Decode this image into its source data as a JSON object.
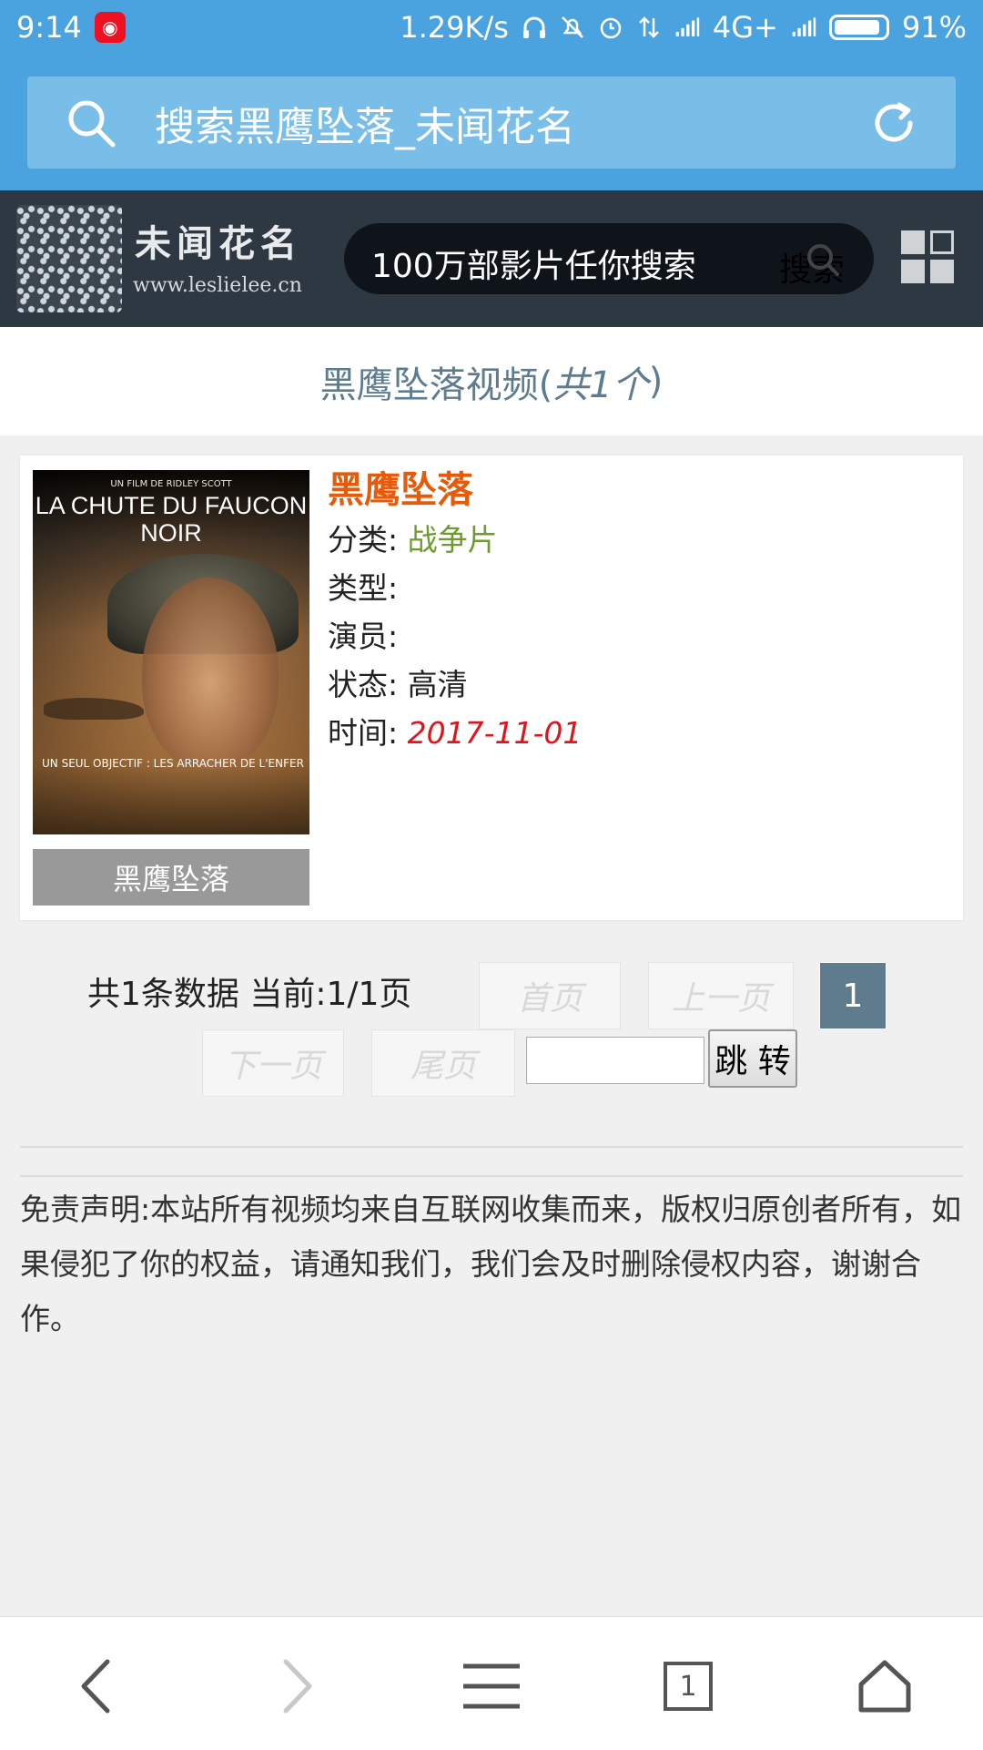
{
  "status_bar": {
    "time": "9:14",
    "net_speed": "1.29K/s",
    "network": "4G+",
    "battery": "91%",
    "battery_level": 0.91
  },
  "browser": {
    "url_text": "搜索黑鹰坠落_未闻花名",
    "icons": {
      "search": "search-icon",
      "refresh": "refresh-icon"
    }
  },
  "site": {
    "logo_title": "未闻花名",
    "logo_url": "www.leslielee.cn",
    "search_placeholder": "100万部影片任你搜索",
    "search_button": "搜索"
  },
  "section": {
    "heading_prefix": "黑鹰坠落视频(",
    "heading_count": "共1个",
    "heading_suffix": ")"
  },
  "movie": {
    "title": "黑鹰坠落",
    "poster_caption": "黑鹰坠落",
    "poster_text": {
      "top": "UN FILM DE RIDLEY SCOTT",
      "title": "LA CHUTE DU FAUCON NOIR",
      "tagline": "UN SEUL OBJECTIF : LES ARRACHER DE L'ENFER"
    },
    "fields": {
      "category_label": "分类:",
      "category_value": "战争片",
      "genre_label": "类型:",
      "genre_value": "",
      "actors_label": "演员:",
      "actors_value": "",
      "status_label": "状态:",
      "status_value": "高清",
      "time_label": "时间:",
      "time_value": "2017-11-01"
    }
  },
  "pagination": {
    "summary": "共1条数据 当前:1/1页",
    "first": "首页",
    "prev": "上一页",
    "current": "1",
    "next": "下一页",
    "last": "尾页",
    "jump_input": "",
    "go": "跳 转"
  },
  "disclaimer": "免责声明:本站所有视频均来自互联网收集而来，版权归原创者所有，如果侵犯了你的权益，请通知我们，我们会及时删除侵权内容，谢谢合作。",
  "bottom_nav": {
    "tab_count": "1"
  },
  "colors": {
    "brand_blue": "#4aa3df",
    "header_dark": "#2e3842",
    "title_orange": "#e65a0a",
    "category_green": "#6e9b2e",
    "date_red": "#e0141a",
    "pager_active": "#5f7c8e"
  }
}
